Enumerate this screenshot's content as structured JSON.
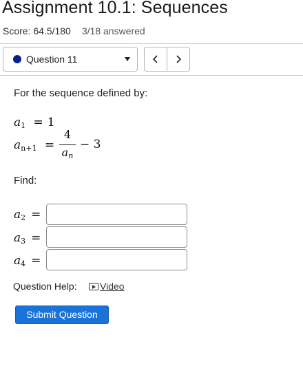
{
  "header": {
    "title": "Assignment 10.1: Sequences",
    "score": "Score: 64.5/180",
    "answered": "3/18 answered"
  },
  "question_nav": {
    "selected": "Question 11",
    "dot_color": "#0b1f8c",
    "prev_icon": "chevron-left-icon",
    "next_icon": "chevron-right-icon"
  },
  "problem": {
    "prompt": "For the sequence defined by:",
    "a1_lhs": "a",
    "a1_sub": "1",
    "a1_rhs": "1",
    "rec_lhs": "a",
    "rec_sub": "n+1",
    "rec_numerator": "4",
    "rec_denominator": "a",
    "rec_denominator_sub": "n",
    "rec_tail": "− 3",
    "find_label": "Find:",
    "answers": [
      {
        "var": "a",
        "sub": "2",
        "value": ""
      },
      {
        "var": "a",
        "sub": "3",
        "value": ""
      },
      {
        "var": "a",
        "sub": "4",
        "value": ""
      }
    ]
  },
  "help": {
    "label": "Question Help:",
    "video_label": "Video",
    "video_icon": "video-play-icon"
  },
  "submit_label": "Submit Question",
  "colors": {
    "submit_bg": "#1a73d8",
    "question_dot": "#0b1f8c"
  }
}
